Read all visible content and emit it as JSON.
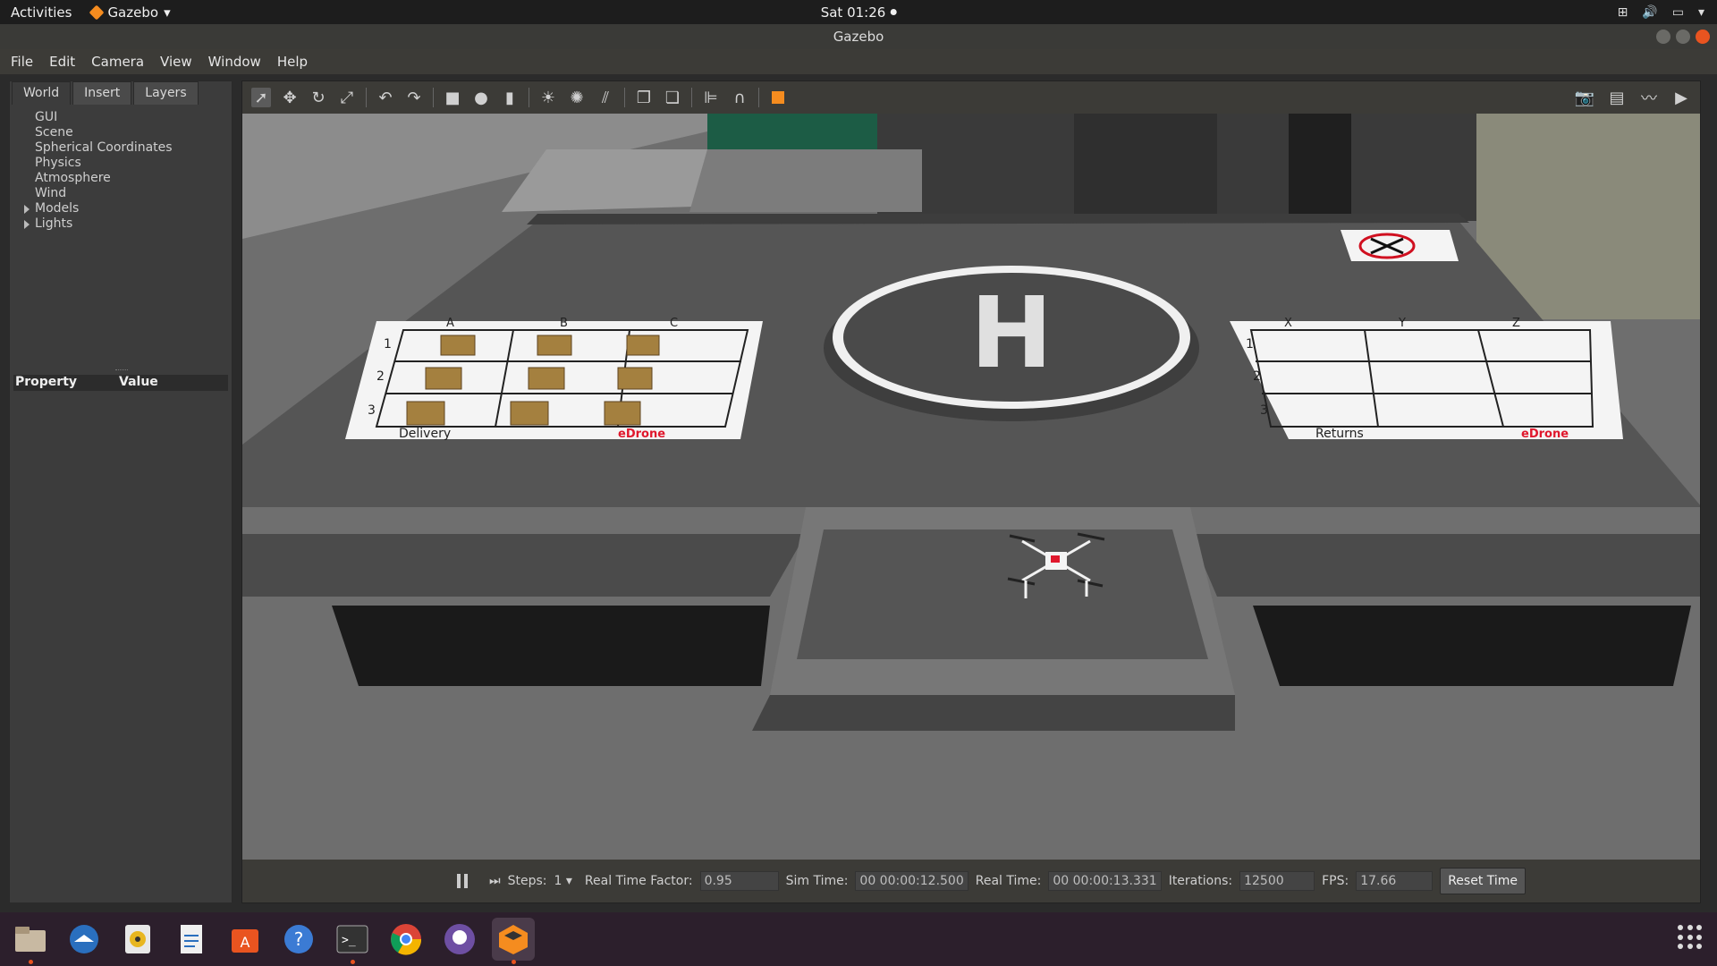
{
  "topbar": {
    "activities": "Activities",
    "app_name": "Gazebo",
    "clock": "Sat 01:26"
  },
  "window": {
    "title": "Gazebo"
  },
  "menu": [
    "File",
    "Edit",
    "Camera",
    "View",
    "Window",
    "Help"
  ],
  "left_panel": {
    "tabs": [
      "World",
      "Insert",
      "Layers"
    ],
    "active_tab": "World",
    "tree": [
      "GUI",
      "Scene",
      "Spherical Coordinates",
      "Physics",
      "Atmosphere",
      "Wind",
      "Models",
      "Lights"
    ],
    "expandable": [
      "Models",
      "Lights"
    ],
    "property_header": "Property",
    "value_header": "Value"
  },
  "toolbar": {
    "icons": [
      "select-arrow-icon",
      "translate-icon",
      "rotate-icon",
      "scale-icon",
      "undo-icon",
      "redo-icon",
      "box-icon",
      "sphere-icon",
      "cylinder-icon",
      "point-light-icon",
      "spot-light-icon",
      "directional-light-icon",
      "copy-icon",
      "paste-icon",
      "align-icon",
      "snap-icon",
      "view-angle-icon"
    ],
    "right_icons": [
      "screenshot-icon",
      "log-icon",
      "plot-icon",
      "record-video-icon"
    ]
  },
  "scene": {
    "delivery_cols": [
      "A",
      "B",
      "C"
    ],
    "rows": [
      "1",
      "2",
      "3"
    ],
    "delivery_label": "Delivery",
    "returns_cols": [
      "X",
      "Y",
      "Z"
    ],
    "returns_label": "Returns",
    "brand": "eDrone",
    "helipad_letter": "H"
  },
  "status": {
    "steps_label": "Steps:",
    "steps_value": "1",
    "rtf_label": "Real Time Factor:",
    "rtf_value": "0.95",
    "sim_time_label": "Sim Time:",
    "sim_time_value": "00 00:00:12.500",
    "real_time_label": "Real Time:",
    "real_time_value": "00 00:00:13.331",
    "iterations_label": "Iterations:",
    "iterations_value": "12500",
    "fps_label": "FPS:",
    "fps_value": "17.66",
    "reset_label": "Reset Time"
  },
  "dock": [
    "files-icon",
    "thunderbird-icon",
    "rhythmbox-icon",
    "writer-icon",
    "software-center-icon",
    "help-icon",
    "terminal-icon",
    "chrome-icon",
    "github-desktop-icon",
    "gazebo-icon"
  ]
}
